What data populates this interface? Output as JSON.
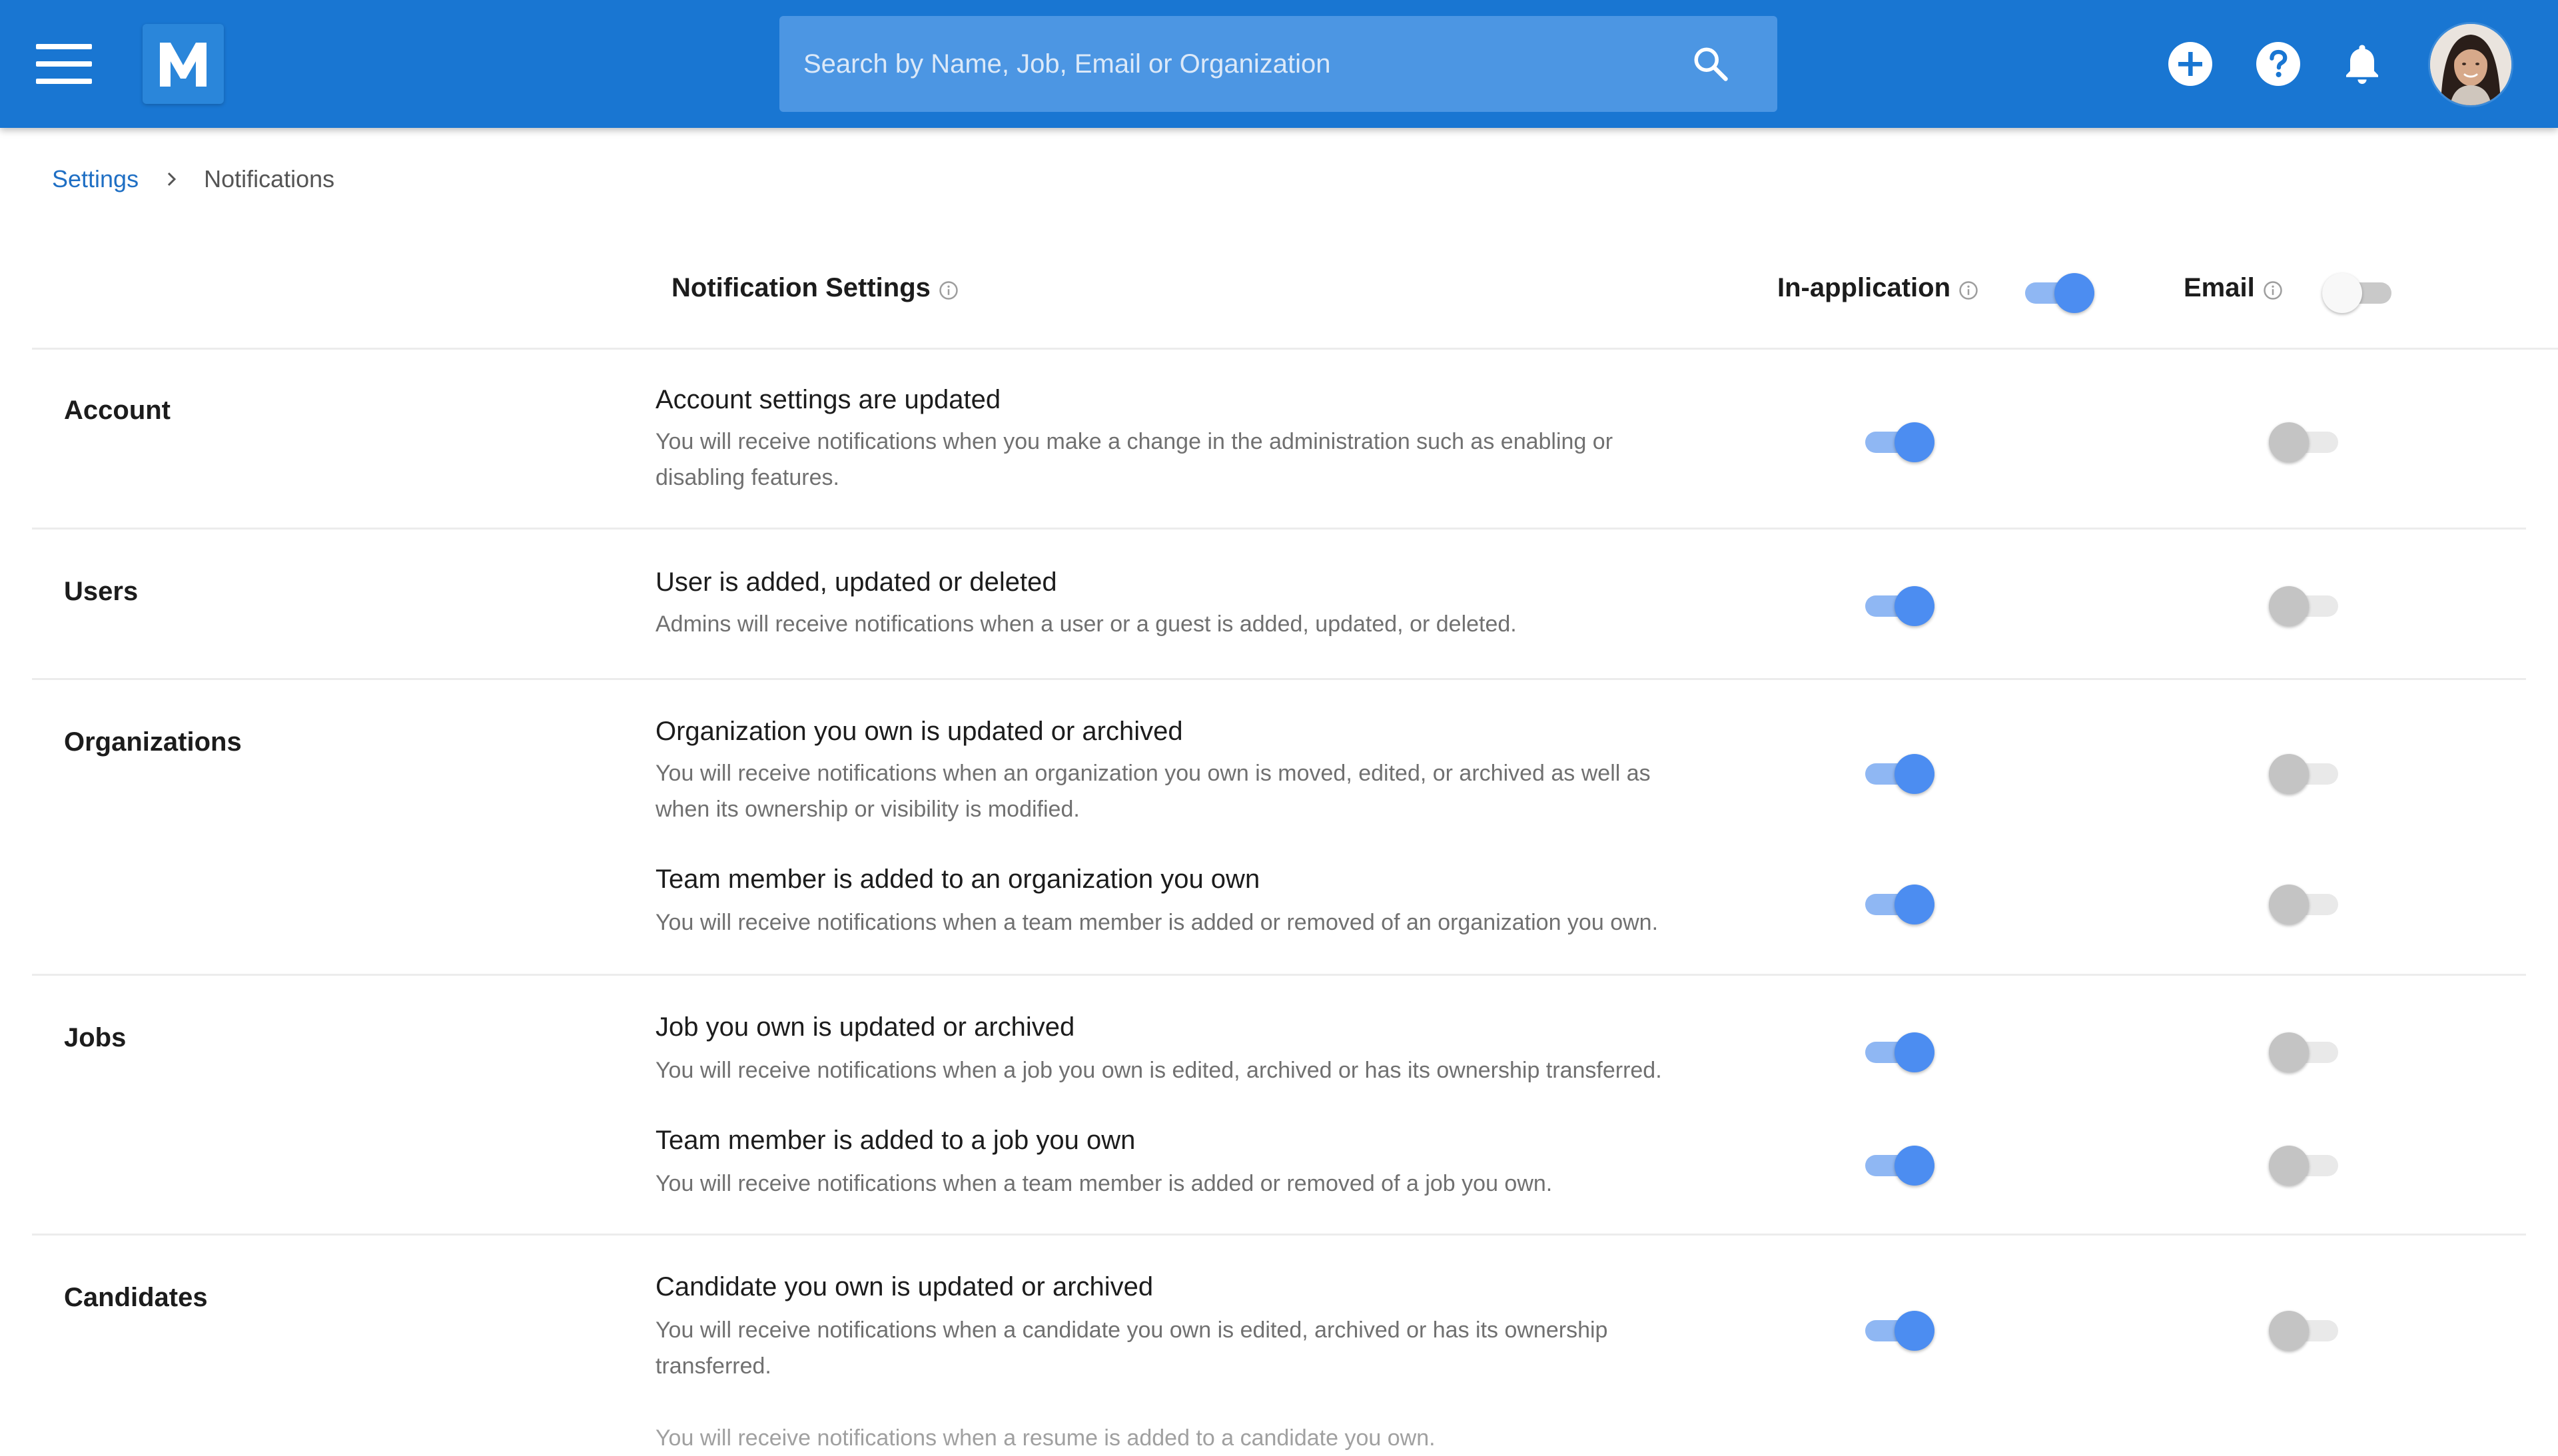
{
  "app": {
    "logo_letter": "M",
    "accent_color": "#1976d2",
    "toggle_on_color": "#4c8df1"
  },
  "search": {
    "placeholder": "Search by Name, Job, Email or Organization",
    "value": ""
  },
  "topbar_icons": [
    "menu-icon",
    "search-icon",
    "add-circle-icon",
    "help-icon",
    "bell-icon",
    "avatar"
  ],
  "breadcrumb": {
    "parent": "Settings",
    "current": "Notifications"
  },
  "columns": {
    "settings_label": "Notification Settings",
    "in_app_label": "In-application",
    "in_app_master_on": true,
    "email_label": "Email",
    "email_master_on": false
  },
  "sections": [
    {
      "category": "Account",
      "items": [
        {
          "title": "Account settings are updated",
          "desc_line1": "You will receive notifications when you make a change in the administration such as enabling or",
          "desc_line2": "disabling features.",
          "in_app": true,
          "email": false
        }
      ]
    },
    {
      "category": "Users",
      "items": [
        {
          "title": "User is added, updated or deleted",
          "desc_line1": "Admins will receive notifications when a user or a guest is added, updated, or deleted.",
          "in_app": true,
          "email": false
        }
      ]
    },
    {
      "category": "Organizations",
      "items": [
        {
          "title": "Organization you own is updated or archived",
          "desc_line1": "You will receive notifications when an organization you own is moved, edited, or archived as well as",
          "desc_line2": "when its ownership or visibility is modified.",
          "in_app": true,
          "email": false
        },
        {
          "title": "Team member is added to an organization you own",
          "desc_line1": "You will receive notifications when a team member is added or removed of an organization you own.",
          "in_app": true,
          "email": false
        }
      ]
    },
    {
      "category": "Jobs",
      "items": [
        {
          "title": "Job you own is updated or archived",
          "desc_line1": "You will receive notifications when a job you own is edited, archived or has its ownership transferred.",
          "in_app": true,
          "email": false
        },
        {
          "title": "Team member is added to a job you own",
          "desc_line1": "You will receive notifications when a team member is added or removed of a job you own.",
          "in_app": true,
          "email": false
        }
      ]
    },
    {
      "category": "Candidates",
      "items": [
        {
          "title": "Candidate you own is updated or archived",
          "desc_line1": "You will receive notifications when a candidate you own is edited, archived or has its ownership",
          "desc_line2": "transferred.",
          "in_app": true,
          "email": false
        },
        {
          "desc_line1": "You will receive notifications when a resume is added to a candidate you own."
        }
      ]
    }
  ]
}
